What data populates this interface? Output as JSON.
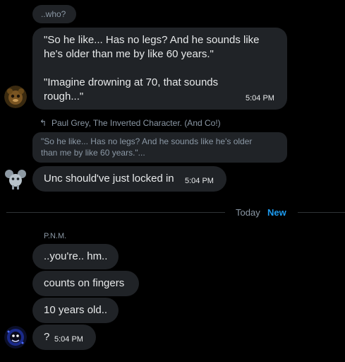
{
  "messages_top": {
    "small_bubble": "..who?",
    "quote_lines": [
      "\"So he like... Has no legs? And he sounds like",
      "he's older than me by like 60 years.\""
    ],
    "quote_lines_2": [
      "\"Imagine drowning at 70, that sounds",
      "rough...\""
    ],
    "time": "5:04 PM"
  },
  "reply": {
    "reply_to": "Paul Grey, The Inverted Character. (And Co!)",
    "quoted_preview_lines": [
      "\"So he like... Has no legs? And he sounds like he's older",
      "than me by like 60 years.\"..."
    ],
    "text": "Unc should've just locked in",
    "time": "5:04 PM"
  },
  "divider": {
    "today": "Today",
    "new": "New"
  },
  "pnm": {
    "sender": "P.N.M.",
    "messages": [
      "..you're.. hm..",
      "counts on fingers",
      "10 years old..",
      "?"
    ],
    "time": "5:04 PM"
  },
  "colors": {
    "bubble": "#202327",
    "accent_new": "#1d9bf0",
    "text": "#e7e9ea",
    "muted": "#8b98a5"
  }
}
